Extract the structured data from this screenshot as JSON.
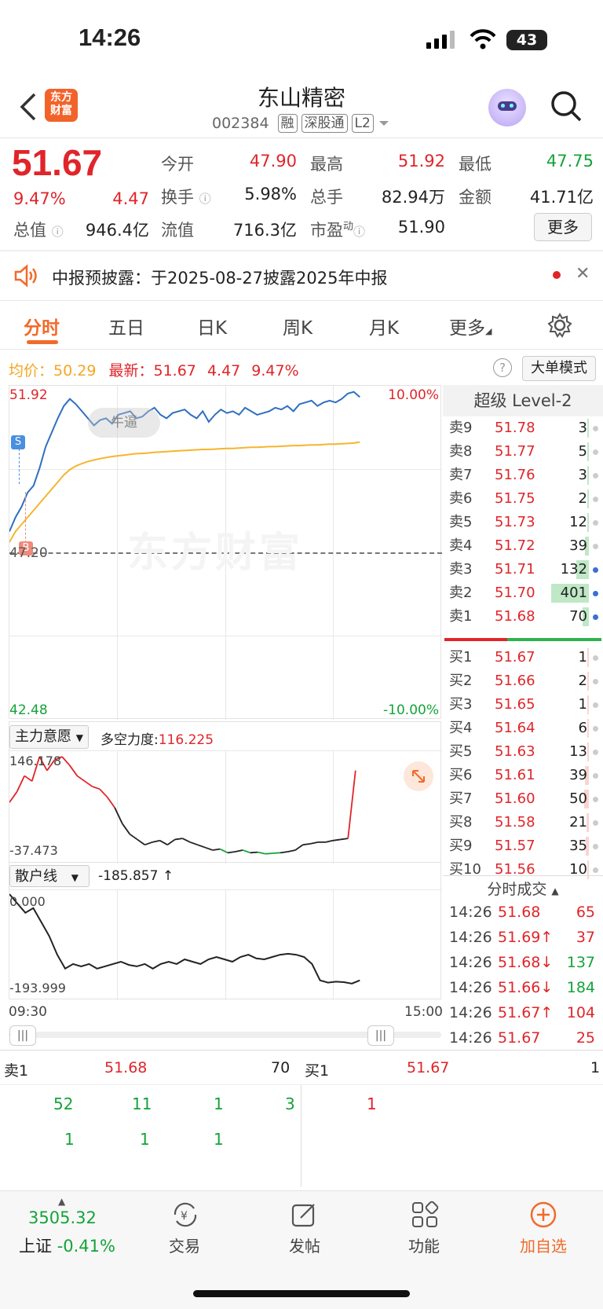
{
  "status_bar": {
    "time": "14:26",
    "battery": "43"
  },
  "header": {
    "logo_text": "东方财富",
    "stock_name": "东山精密",
    "stock_code": "002384",
    "tags": [
      "融",
      "深股通",
      "L2"
    ]
  },
  "quote": {
    "price": "51.67",
    "change_pct": "9.47%",
    "change": "4.47",
    "open_label": "今开",
    "open": "47.90",
    "high_label": "最高",
    "high": "51.92",
    "low_label": "最低",
    "low": "47.75",
    "turnover_label": "换手",
    "turnover": "5.98%",
    "volume_label": "总手",
    "volume": "82.94万",
    "amount_label": "金额",
    "amount": "41.71亿",
    "mktcap_label": "总值",
    "mktcap": "946.4亿",
    "float_label": "流值",
    "float": "716.3亿",
    "pe_label": "市盈",
    "pe_sup": "动",
    "pe": "51.90",
    "more_button": "更多"
  },
  "notice": {
    "text": "中报预披露：于2025-08-27披露2025年中报"
  },
  "tabs": [
    "分时",
    "五日",
    "日K",
    "周K",
    "月K",
    "更多"
  ],
  "chart_info": {
    "avg_label": "均价：",
    "avg": "50.29",
    "latest_label": "最新：",
    "latest": "51.67",
    "latest_chg": "4.47",
    "latest_pct": "9.47%",
    "big_order_button": "大单模式"
  },
  "chart_axes": {
    "y_top": "51.92",
    "y_mid": "47.20",
    "y_bot": "42.48",
    "pct_top": "10.00%",
    "pct_bot": "-10.00%",
    "x_start": "09:30",
    "x_end": "15:00",
    "watermark": "东方财富",
    "bubble": "牛逼",
    "marker_s": "S",
    "marker_b": "B"
  },
  "chart_data": {
    "type": "line",
    "title": "",
    "ylim": [
      42.48,
      51.92
    ],
    "series": [
      {
        "name": "price",
        "color": "#2f6fc0",
        "values": [
          47.8,
          48.2,
          48.5,
          48.9,
          49.1,
          49.6,
          50.2,
          50.6,
          51.0,
          51.35,
          51.55,
          51.4,
          51.2,
          51.0,
          50.8,
          50.95,
          51.0,
          50.85,
          51.1,
          51.15,
          51.2,
          51.0,
          51.05,
          51.2,
          51.3,
          51.1,
          51.0,
          51.15,
          51.2,
          51.25,
          51.1,
          51.0,
          51.2,
          50.9,
          51.1,
          51.25,
          51.15,
          51.2,
          51.1,
          51.3,
          51.2,
          51.1,
          51.15,
          51.2,
          51.3,
          51.25,
          51.35,
          51.2,
          51.4,
          51.45,
          51.5,
          51.35,
          51.45,
          51.5,
          51.45,
          51.55,
          51.7,
          51.75,
          51.6
        ]
      },
      {
        "name": "avg",
        "color": "#f5b52e",
        "values": [
          47.5,
          47.8,
          48.0,
          48.2,
          48.4,
          48.6,
          48.8,
          49.0,
          49.2,
          49.4,
          49.55,
          49.65,
          49.72,
          49.78,
          49.82,
          49.86,
          49.89,
          49.92,
          49.94,
          49.96,
          49.98,
          50.0,
          50.01,
          50.02,
          50.04,
          50.05,
          50.06,
          50.07,
          50.08,
          50.09,
          50.1,
          50.11,
          50.12,
          50.12,
          50.13,
          50.14,
          50.15,
          50.15,
          50.16,
          50.17,
          50.18,
          50.18,
          50.19,
          50.2,
          50.2,
          50.21,
          50.22,
          50.23,
          50.23,
          50.24,
          50.25,
          50.25,
          50.26,
          50.27,
          50.27,
          50.28,
          50.29,
          50.3,
          50.33
        ]
      }
    ]
  },
  "indicator1": {
    "select": "主力意愿",
    "label": "多空力度:",
    "value": "116.225",
    "ymax": "146.178",
    "ymin": "-37.473",
    "values": [
      60,
      80,
      110,
      100,
      146,
      120,
      140,
      146,
      130,
      110,
      100,
      90,
      85,
      70,
      50,
      20,
      0,
      -10,
      -20,
      -15,
      -12,
      -20,
      -10,
      -8,
      -15,
      -20,
      -25,
      -30,
      -28,
      -35,
      -33,
      -30,
      -35,
      -34,
      -37,
      -36,
      -35,
      -33,
      -30,
      -20,
      -18,
      -15,
      -15,
      -12,
      -10,
      -8,
      120
    ]
  },
  "indicator2": {
    "select": "散户线",
    "value": "-185.857 ↑",
    "ymax": "0.000",
    "ymin": "-193.999",
    "values": [
      0,
      -20,
      -40,
      -30,
      -60,
      -90,
      -130,
      -160,
      -150,
      -155,
      -150,
      -160,
      -155,
      -150,
      -145,
      -152,
      -155,
      -150,
      -160,
      -150,
      -145,
      -150,
      -140,
      -145,
      -150,
      -140,
      -135,
      -140,
      -145,
      -135,
      -130,
      -138,
      -140,
      -135,
      -130,
      -128,
      -130,
      -135,
      -150,
      -185,
      -190,
      -188,
      -189,
      -192,
      -185
    ]
  },
  "level2": {
    "title": "超级 Level-2",
    "sell": [
      {
        "label": "卖9",
        "price": "51.78",
        "vol": "3"
      },
      {
        "label": "卖8",
        "price": "51.77",
        "vol": "5"
      },
      {
        "label": "卖7",
        "price": "51.76",
        "vol": "3"
      },
      {
        "label": "卖6",
        "price": "51.75",
        "vol": "2"
      },
      {
        "label": "卖5",
        "price": "51.73",
        "vol": "12"
      },
      {
        "label": "卖4",
        "price": "51.72",
        "vol": "39"
      },
      {
        "label": "卖3",
        "price": "51.71",
        "vol": "132"
      },
      {
        "label": "卖2",
        "price": "51.70",
        "vol": "401"
      },
      {
        "label": "卖1",
        "price": "51.68",
        "vol": "70"
      }
    ],
    "buy": [
      {
        "label": "买1",
        "price": "51.67",
        "vol": "1"
      },
      {
        "label": "买2",
        "price": "51.66",
        "vol": "2"
      },
      {
        "label": "买3",
        "price": "51.65",
        "vol": "1"
      },
      {
        "label": "买4",
        "price": "51.64",
        "vol": "6"
      },
      {
        "label": "买5",
        "price": "51.63",
        "vol": "13"
      },
      {
        "label": "买6",
        "price": "51.61",
        "vol": "39"
      },
      {
        "label": "买7",
        "price": "51.60",
        "vol": "50"
      },
      {
        "label": "买8",
        "price": "51.58",
        "vol": "21"
      },
      {
        "label": "买9",
        "price": "51.57",
        "vol": "35"
      },
      {
        "label": "买10",
        "price": "51.56",
        "vol": "10"
      }
    ],
    "ticks_title": "分时成交",
    "ticks": [
      {
        "time": "14:26",
        "price": "51.68",
        "vol": "65"
      },
      {
        "time": "14:26",
        "price": "51.69↑",
        "vol": "37"
      },
      {
        "time": "14:26",
        "price": "51.68↓",
        "vol": "137"
      },
      {
        "time": "14:26",
        "price": "51.66↓",
        "vol": "184"
      },
      {
        "time": "14:26",
        "price": "51.67↑",
        "vol": "104"
      },
      {
        "time": "14:26",
        "price": "51.67",
        "vol": "25"
      }
    ]
  },
  "queue": {
    "sell_label": "卖1",
    "sell_price": "51.68",
    "sell_vol": "70",
    "buy_label": "买1",
    "buy_price": "51.67",
    "buy_vol": "1",
    "sell_row1": [
      "52",
      "11",
      "1",
      "3"
    ],
    "sell_row2": [
      "1",
      "1",
      "1"
    ],
    "buy_row1": [
      "1"
    ]
  },
  "bottom_nav": {
    "index_value": "3505.32",
    "index_name": "上证",
    "index_pct": "-0.41%",
    "trade": "交易",
    "post": "发帖",
    "func": "功能",
    "add": "加自选"
  }
}
